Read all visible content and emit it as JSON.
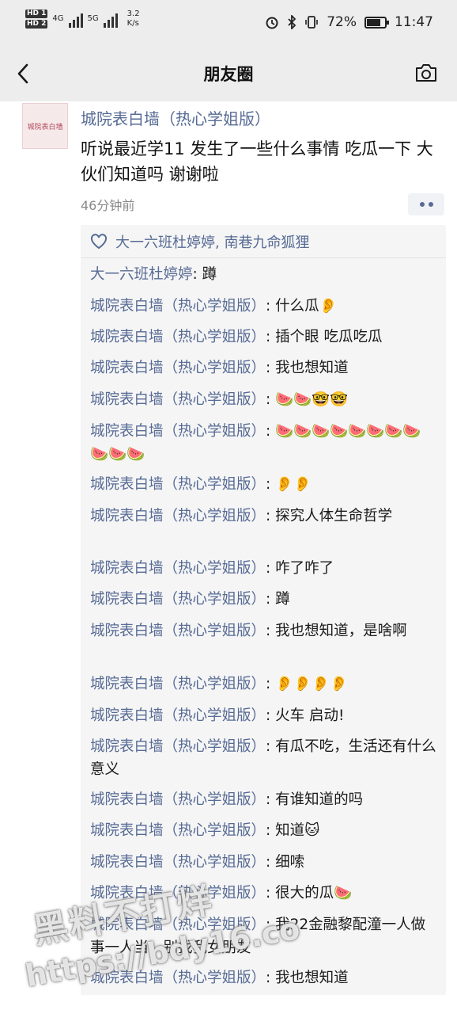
{
  "status_bar": {
    "hd1": "HD 1",
    "hd2": "HD 2",
    "net1": "4G",
    "net2": "5G",
    "speed": "3.2",
    "speed_unit": "K/s",
    "battery": "72%",
    "time": "11:47"
  },
  "nav": {
    "title": "朋友圈"
  },
  "post": {
    "avatar_text": "城院表白墙",
    "poster": "城院表白墙（热心学姐版）",
    "text": "听说最近学11 发生了一些什么事情  吃瓜一下  大伙们知道吗  谢谢啦",
    "time": "46分钟前"
  },
  "likes": "大一六班杜婷婷, 南巷九命狐狸",
  "comments": [
    {
      "name": "大一六班杜婷婷",
      "text": "蹲"
    },
    {
      "name": "城院表白墙（热心学姐版）",
      "text": "什么瓜👂"
    },
    {
      "name": "城院表白墙（热心学姐版）",
      "text": "插个眼 吃瓜吃瓜"
    },
    {
      "name": "城院表白墙（热心学姐版）",
      "text": "我也想知道"
    },
    {
      "name": "城院表白墙（热心学姐版）",
      "text": "🍉🍉🤓🤓"
    },
    {
      "name": "城院表白墙（热心学姐版）",
      "text": "🍉🍉🍉🍉🍉🍉🍉🍉🍉🍉🍉"
    },
    {
      "name": "城院表白墙（热心学姐版）",
      "text": "👂👂"
    },
    {
      "name": "城院表白墙（热心学姐版）",
      "text": "探究人体生命哲学"
    },
    {
      "name": "城院表白墙（热心学姐版）",
      "text": "咋了咋了"
    },
    {
      "name": "城院表白墙（热心学姐版）",
      "text": "蹲"
    },
    {
      "name": "城院表白墙（热心学姐版）",
      "text": "我也想知道，是啥啊"
    },
    {
      "name": "城院表白墙（热心学姐版）",
      "text": "👂👂👂👂"
    },
    {
      "name": "城院表白墙（热心学姐版）",
      "text": "火车 启动!"
    },
    {
      "name": "城院表白墙（热心学姐版）",
      "text": "有瓜不吃，生活还有什么意义"
    },
    {
      "name": "城院表白墙（热心学姐版）",
      "text": "有谁知道的吗"
    },
    {
      "name": "城院表白墙（热心学姐版）",
      "text": "知道🐱"
    },
    {
      "name": "城院表白墙（热心学姐版）",
      "text": "细嗦"
    },
    {
      "name": "城院表白墙（热心学姐版）",
      "text": "很大的瓜🍉"
    },
    {
      "name": "城院表白墙（热心学姐版）",
      "text": "我22金融黎配潼一人做事一人当，别找我女朋友"
    },
    {
      "name": "城院表白墙（热心学姐版）",
      "text": "我也想知道"
    }
  ],
  "watermark": {
    "line1": "黑料不打烊",
    "line2": "https://bdy16.co"
  },
  "colors": {
    "link": "#576b95",
    "background": "#ededed"
  }
}
